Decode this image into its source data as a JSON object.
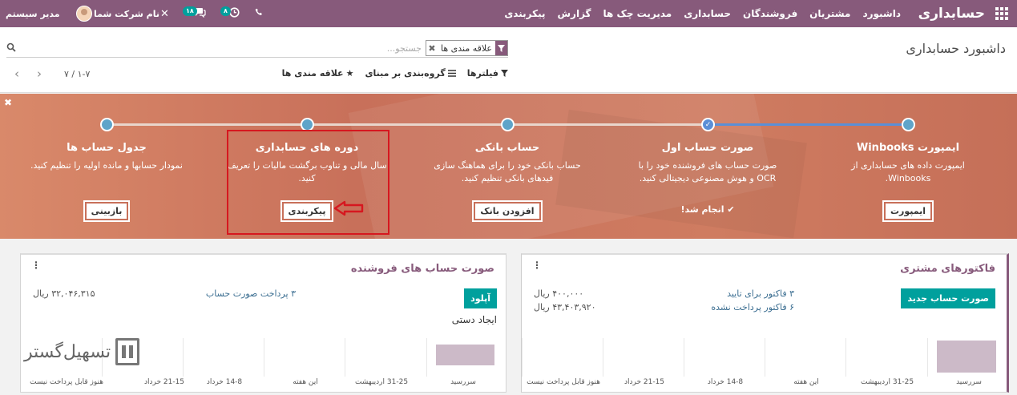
{
  "navbar": {
    "brand": "حسابداری",
    "menu": [
      "داشبورد",
      "مشتریان",
      "فروشندگان",
      "حسابداری",
      "مدیریت چک ها",
      "گزارش",
      "پیکربندی"
    ],
    "user_name": "مدیر سیستم",
    "company_name": "نام شرکت شما",
    "messages_badge": "۱۸",
    "activities_badge": "۸",
    "accent_color": "#875a7b"
  },
  "control_panel": {
    "breadcrumb": "داشبورد حسابداری",
    "search_placeholder": "جستجو...",
    "facet_label": "علاقه مندی ها",
    "filters_label": "فیلترها",
    "groupby_label": "گروه‌بندی بر مبنای",
    "favorites_label": "علاقه مندی ها",
    "pager_value": "۱-۷ / ۷"
  },
  "banner": {
    "steps": [
      {
        "title": "ایمپورت Winbooks",
        "desc": "ایمپورت داده های حسابداری از Winbooks.",
        "button": "ایمپورت",
        "state": "todo"
      },
      {
        "title": "صورت حساب اول",
        "desc": "صورت حساب های فروشنده خود را با OCR و هوش مصنوعی دیجیتالی کنید.",
        "done_label": "انجام شد!",
        "state": "done"
      },
      {
        "title": "حساب بانکی",
        "desc": "حساب بانکی خود را برای هماهنگ سازی فیدهای بانکی تنظیم کنید.",
        "button": "افزودن بانک",
        "state": "todo"
      },
      {
        "title": "دوره های حسابداری",
        "desc": "سال مالی و تناوب برگشت مالیات را تعریف کنید.",
        "button": "پیکربندی",
        "state": "todo"
      },
      {
        "title": "جدول حساب ها",
        "desc": "نمودار حسابها و مانده اولیه را تنظیم کنید.",
        "button": "بازبینی",
        "state": "todo"
      }
    ]
  },
  "customer_invoices": {
    "title": "فاکتورهای مشتری",
    "button": "صورت حساب جدید",
    "line1_label": "۳ فاکتور برای تایید",
    "line1_amount": "۴۰۰,۰۰۰ ریال",
    "line2_label": "۶ فاکتور پرداخت نشده",
    "line2_amount": "۴۳,۴۰۳,۹۲۰ ریال",
    "chart_labels": [
      "سررسید",
      "31-25 اردیبهشت",
      "این هفته",
      "14-8 خرداد",
      "21-15 خرداد",
      "هنوز قابل پرداخت نیست"
    ]
  },
  "vendor_bills": {
    "title": "صورت حساب های فروشنده",
    "button": "آپلود",
    "sub_label": "ایجاد دستی",
    "line1_label": "۳ پرداخت صورت حساب",
    "line1_amount": "۳۲,۰۴۶,۳۱۵ ریال",
    "chart_labels": [
      "سررسید",
      "31-25 اردیبهشت",
      "این هفته",
      "14-8 خرداد",
      "21-15 خرداد",
      "هنوز قابل پرداخت نیست"
    ]
  },
  "watermark": {
    "text": "تسهیل‌گستر"
  }
}
